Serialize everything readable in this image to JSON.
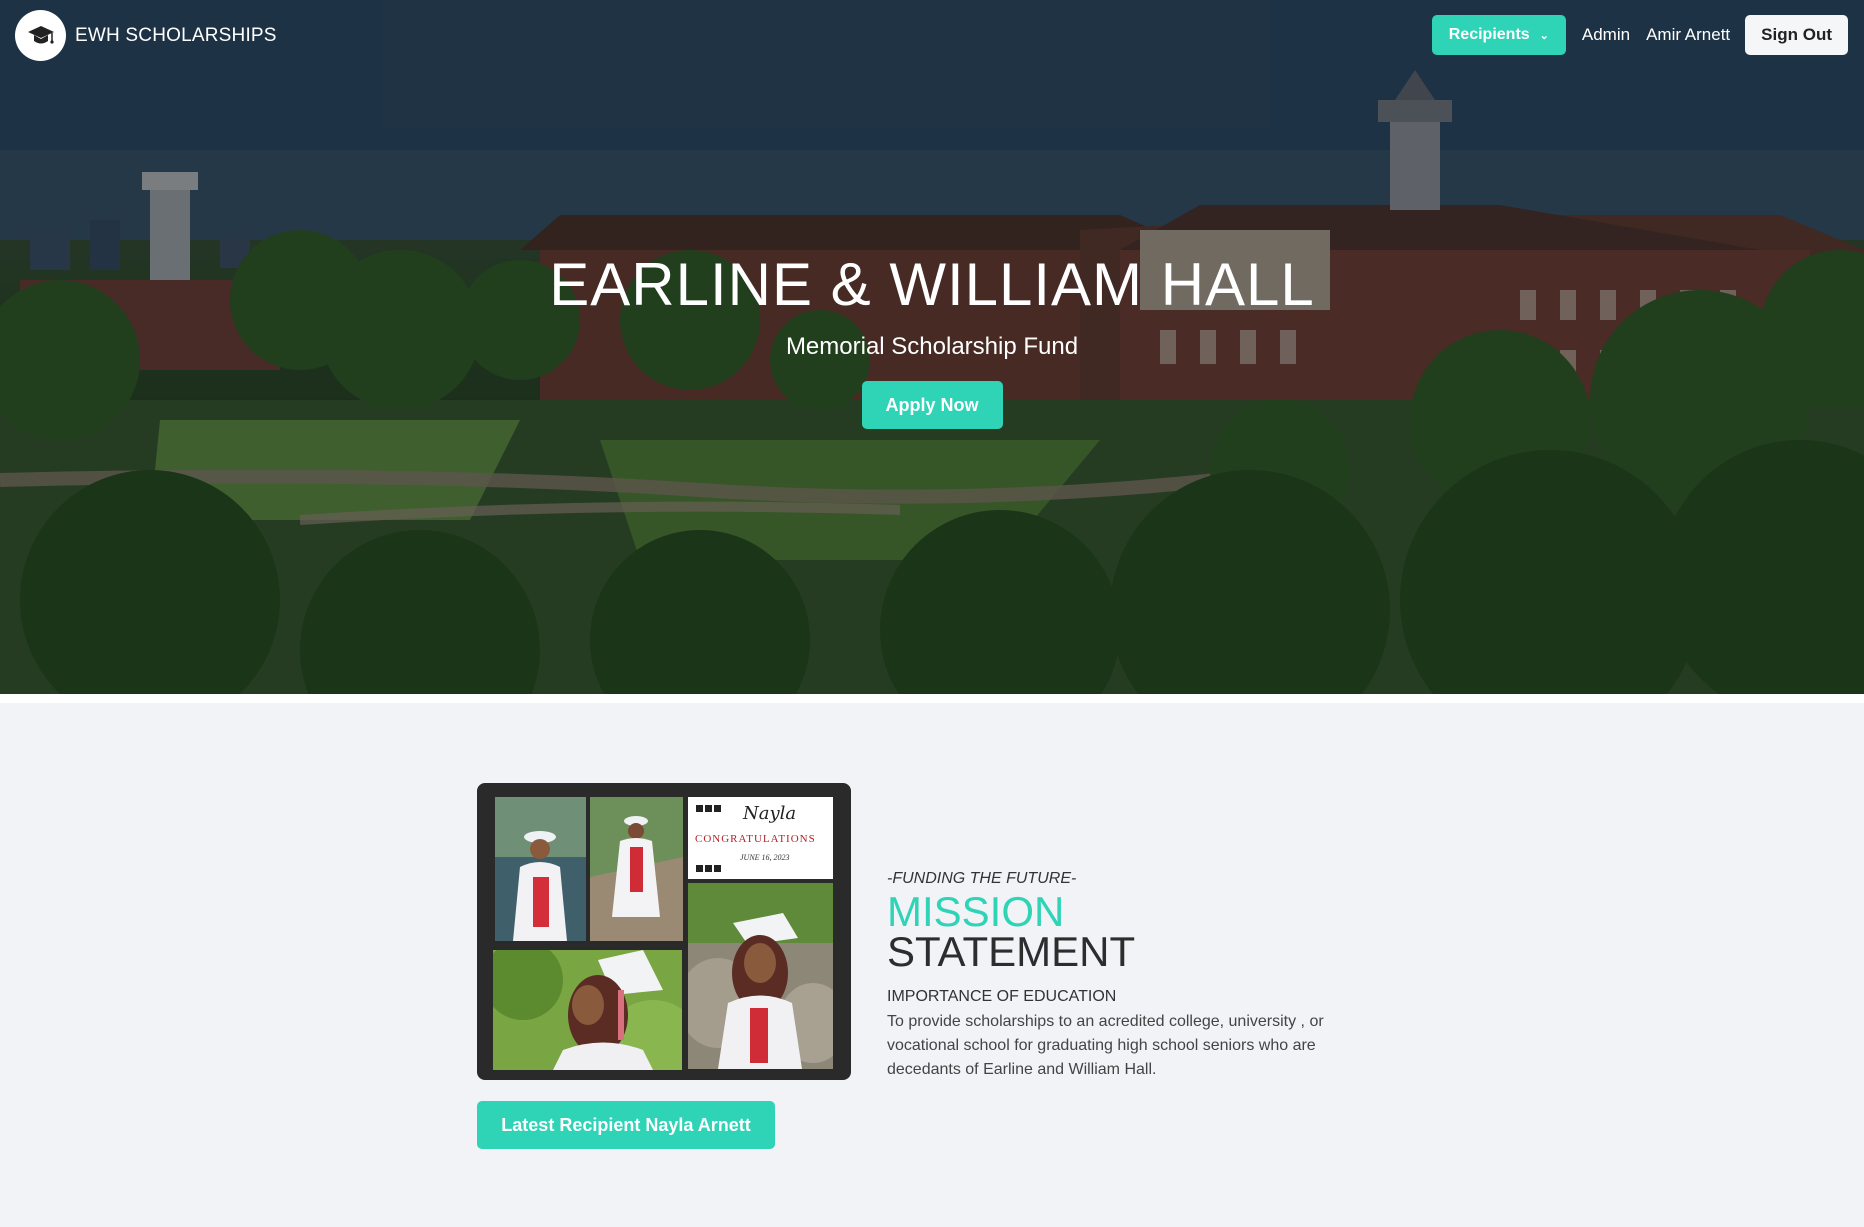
{
  "brand": {
    "name": "EWH SCHOLARSHIPS",
    "logo_icon": "graduation-cap-icon"
  },
  "nav": {
    "recipients_label": "Recipients",
    "recipients_icon": "chevron-down-icon",
    "admin_label": "Admin",
    "user_name": "Amir Arnett",
    "sign_out_label": "Sign Out"
  },
  "hero": {
    "title": "EARLINE & WILLIAM HALL",
    "subtitle": "Memorial Scholarship Fund",
    "apply_label": "Apply Now"
  },
  "collage": {
    "card_name": "Nayla",
    "card_message": "CONGRATULATIONS",
    "card_date": "JUNE 16, 2023"
  },
  "latest_recipient_label": "Latest Recipient Nayla Arnett",
  "mission": {
    "kicker": "-FUNDING THE FUTURE-",
    "heading_accent": "MISSION",
    "heading": "STATEMENT",
    "subheading": "IMPORTANCE OF EDUCATION",
    "body": "To provide scholarships to an acredited college, university , or vocational school for graduating high school seniors who are decedants of Earline and William Hall."
  },
  "colors": {
    "accent": "#2fd3b6",
    "page_bg": "#f1f3f7"
  }
}
